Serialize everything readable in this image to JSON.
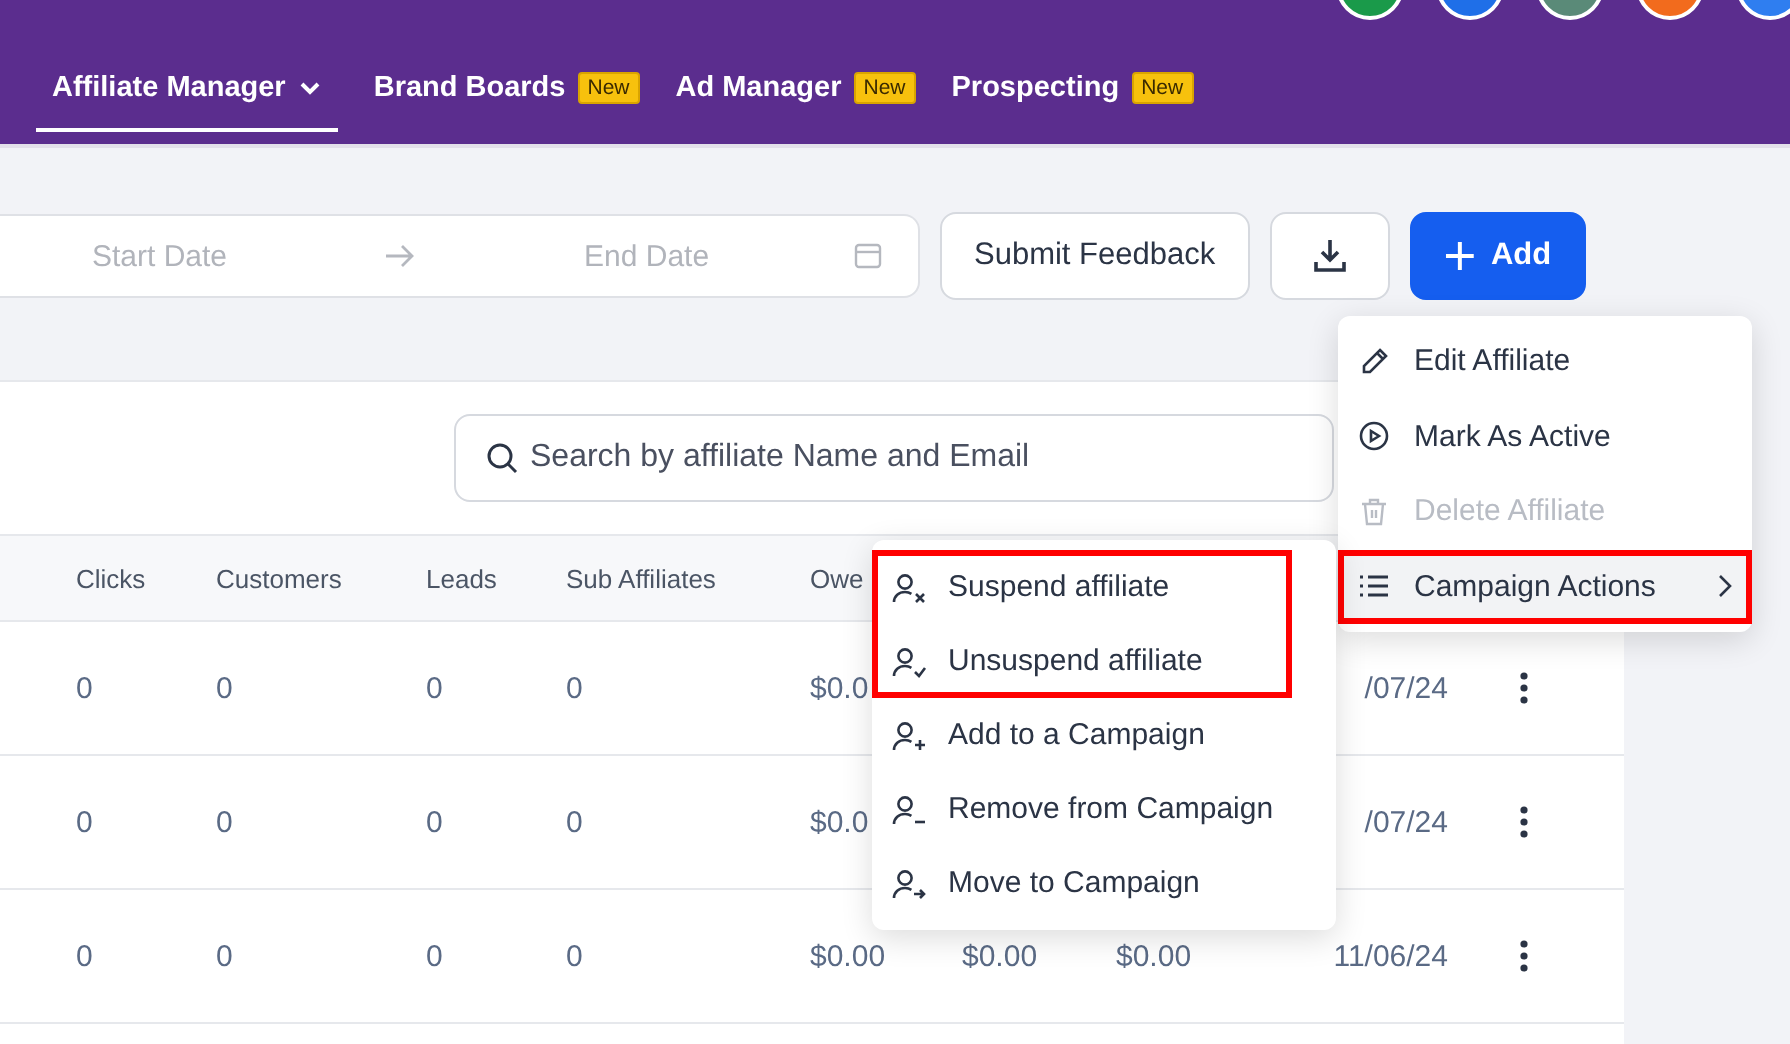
{
  "avatars": [
    {
      "color": "#1a9a4a"
    },
    {
      "color": "#1f6fe8"
    },
    {
      "color": "#5a8a78"
    },
    {
      "color": "#f26b1d"
    },
    {
      "color": "#2f7ef0"
    }
  ],
  "nav": [
    {
      "label": "Affiliate Manager",
      "selected": true,
      "dropdown": true
    },
    {
      "label": "Brand Boards",
      "selected": false,
      "badge": "New"
    },
    {
      "label": "Ad Manager",
      "selected": false,
      "badge": "New"
    },
    {
      "label": "Prospecting",
      "selected": false,
      "badge": "New"
    }
  ],
  "date_range": {
    "start_placeholder": "Start Date",
    "end_placeholder": "End Date"
  },
  "buttons": {
    "feedback": "Submit Feedback",
    "add": "Add"
  },
  "search": {
    "placeholder": "Search by affiliate Name and Email"
  },
  "table": {
    "columns": [
      "Clicks",
      "Customers",
      "Leads",
      "Sub Affiliates",
      "Owe"
    ],
    "rows": [
      [
        "0",
        "0",
        "0",
        "0",
        "$0.0",
        "",
        "",
        "/07/24"
      ],
      [
        "0",
        "0",
        "0",
        "0",
        "$0.0",
        "",
        "",
        "/07/24"
      ],
      [
        "0",
        "0",
        "0",
        "0",
        "$0.00",
        "$0.00",
        "$0.00",
        "11/06/24"
      ]
    ]
  },
  "menu": [
    {
      "label": "Edit Affiliate",
      "kind": "edit",
      "disabled": false,
      "expanded": false,
      "highlighted": false
    },
    {
      "label": "Mark As Active",
      "kind": "play",
      "disabled": false,
      "expanded": false,
      "highlighted": false
    },
    {
      "label": "Delete Affiliate",
      "kind": "delete",
      "disabled": true,
      "expanded": false,
      "highlighted": false
    },
    {
      "label": "Campaign Actions",
      "kind": "list",
      "disabled": false,
      "expanded": true,
      "highlighted": true
    }
  ],
  "submenu": [
    {
      "label": "Suspend affiliate",
      "kind": "user-x",
      "highlighted": true
    },
    {
      "label": "Unsuspend affiliate",
      "kind": "user-check",
      "highlighted": true
    },
    {
      "label": "Add to a Campaign",
      "kind": "user-plus",
      "highlighted": false
    },
    {
      "label": "Remove from Campaign",
      "kind": "user-minus",
      "highlighted": false
    },
    {
      "label": "Move to Campaign",
      "kind": "user-arrow",
      "highlighted": false
    }
  ]
}
